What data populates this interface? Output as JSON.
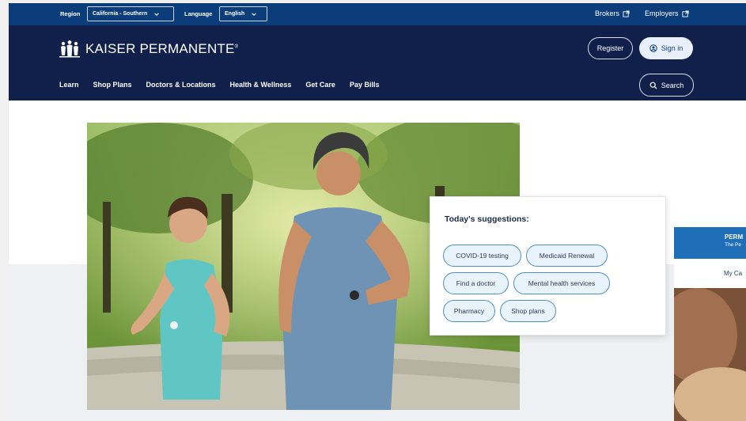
{
  "utility": {
    "region_label": "Region",
    "region_value": "California - Southern",
    "language_label": "Language",
    "language_value": "English",
    "brokers": "Brokers",
    "employers": "Employers"
  },
  "header": {
    "logo_text": "KAISER PERMANENTE",
    "logo_mark": "®",
    "register": "Register",
    "sign_in": "Sign in",
    "search": "Search",
    "nav": [
      "Learn",
      "Shop Plans",
      "Doctors & Locations",
      "Health & Wellness",
      "Get Care",
      "Pay Bills"
    ]
  },
  "suggestions": {
    "title": "Today's suggestions:",
    "chips": [
      "COVID-19 testing",
      "Medicaid Renewal",
      "Find a doctor",
      "Mental health services",
      "Pharmacy",
      "Shop plans"
    ]
  },
  "side_card": {
    "title": "PERM",
    "subtitle": "The Pe",
    "item": "My Ca"
  },
  "colors": {
    "utility_bar": "#0b3d7a",
    "main_nav": "#10204a",
    "chip_border": "#4f8fc4",
    "card_header": "#1f6fb8"
  },
  "icons": [
    "chevron-down-icon",
    "external-link-icon",
    "kp-logo-icon",
    "user-icon",
    "search-icon"
  ]
}
